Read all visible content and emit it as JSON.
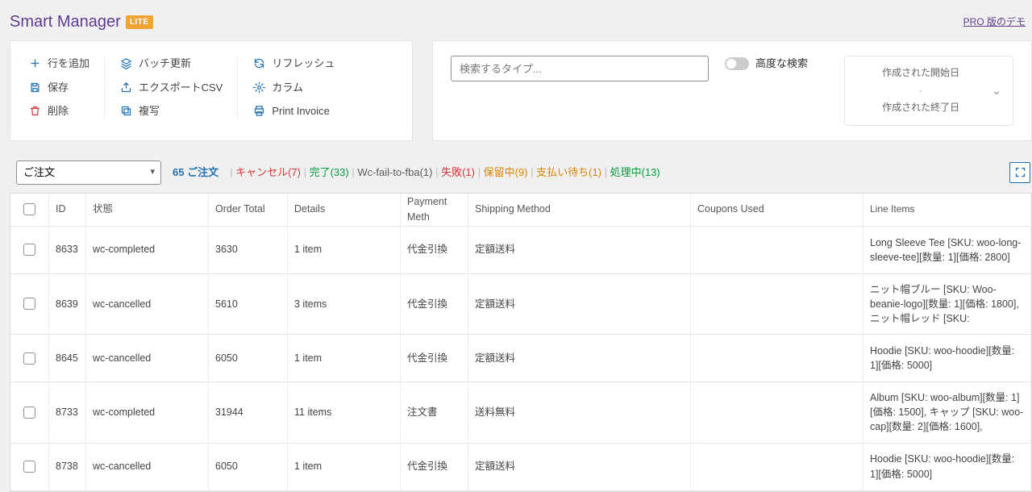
{
  "header": {
    "title": "Smart Manager",
    "badge": "LITE",
    "pro_link": "PRO 版のデモ"
  },
  "actions": {
    "col1": [
      {
        "icon": "plus",
        "label": "行を追加",
        "key": "add-row"
      },
      {
        "icon": "save",
        "label": "保存",
        "key": "save"
      },
      {
        "icon": "trash",
        "label": "削除",
        "key": "delete"
      }
    ],
    "col2": [
      {
        "icon": "layers",
        "label": "バッチ更新",
        "key": "batch"
      },
      {
        "icon": "export",
        "label": "エクスポートCSV",
        "key": "export"
      },
      {
        "icon": "copy",
        "label": "複写",
        "key": "duplicate"
      }
    ],
    "col3": [
      {
        "icon": "refresh",
        "label": "リフレッシュ",
        "key": "refresh"
      },
      {
        "icon": "gear",
        "label": "カラム",
        "key": "columns"
      },
      {
        "icon": "printer",
        "label": "Print Invoice",
        "key": "print"
      }
    ]
  },
  "search": {
    "placeholder": "検索するタイプ...",
    "advanced_label": "高度な検索"
  },
  "date": {
    "start": "作成された開始日",
    "end": "作成された終了日",
    "dash": "-"
  },
  "table_top": {
    "dashboard_selected": "ご注文",
    "count_label": "65 ご注文",
    "statuses": [
      {
        "label": "キャンセル(7)",
        "color": "c-red"
      },
      {
        "label": "完了(33)",
        "color": "c-green"
      },
      {
        "label": "Wc-fail-to-fba(1)",
        "color": "c-gray"
      },
      {
        "label": "失敗(1)",
        "color": "c-red"
      },
      {
        "label": "保留中(9)",
        "color": "c-orange"
      },
      {
        "label": "支払い待ち(1)",
        "color": "c-orange"
      },
      {
        "label": "処理中(13)",
        "color": "c-green"
      }
    ]
  },
  "columns": {
    "id": "ID",
    "status": "状態",
    "total": "Order Total",
    "details": "Details",
    "payment": "Payment Meth",
    "shipping": "Shipping Method",
    "coupons": "Coupons Used",
    "line": "Line Items"
  },
  "rows": [
    {
      "id": "8633",
      "status": "wc-completed",
      "total": "3630",
      "details": "1 item",
      "payment": "代金引換",
      "shipping": "定額送料",
      "coupons": "",
      "line": "Long Sleeve Tee [SKU: woo-long-sleeve-tee][数量: 1][価格: 2800]"
    },
    {
      "id": "8639",
      "status": "wc-cancelled",
      "total": "5610",
      "details": "3 items",
      "payment": "代金引換",
      "shipping": "定額送料",
      "coupons": "",
      "line": "ニット帽ブルー [SKU: Woo-beanie-logo][数量: 1][価格: 1800], ニット帽レッド [SKU:"
    },
    {
      "id": "8645",
      "status": "wc-cancelled",
      "total": "6050",
      "details": "1 item",
      "payment": "代金引換",
      "shipping": "定額送料",
      "coupons": "",
      "line": "Hoodie [SKU: woo-hoodie][数量: 1][価格: 5000]"
    },
    {
      "id": "8733",
      "status": "wc-completed",
      "total": "31944",
      "details": "11 items",
      "payment": "注文書",
      "shipping": "送料無料",
      "coupons": "",
      "line": "Album [SKU: woo-album][数量: 1][価格: 1500], キャップ [SKU: woo-cap][数量: 2][価格: 1600],"
    },
    {
      "id": "8738",
      "status": "wc-cancelled",
      "total": "6050",
      "details": "1 item",
      "payment": "代金引換",
      "shipping": "定額送料",
      "coupons": "",
      "line": "Hoodie [SKU: woo-hoodie][数量: 1][価格: 5000]"
    }
  ]
}
